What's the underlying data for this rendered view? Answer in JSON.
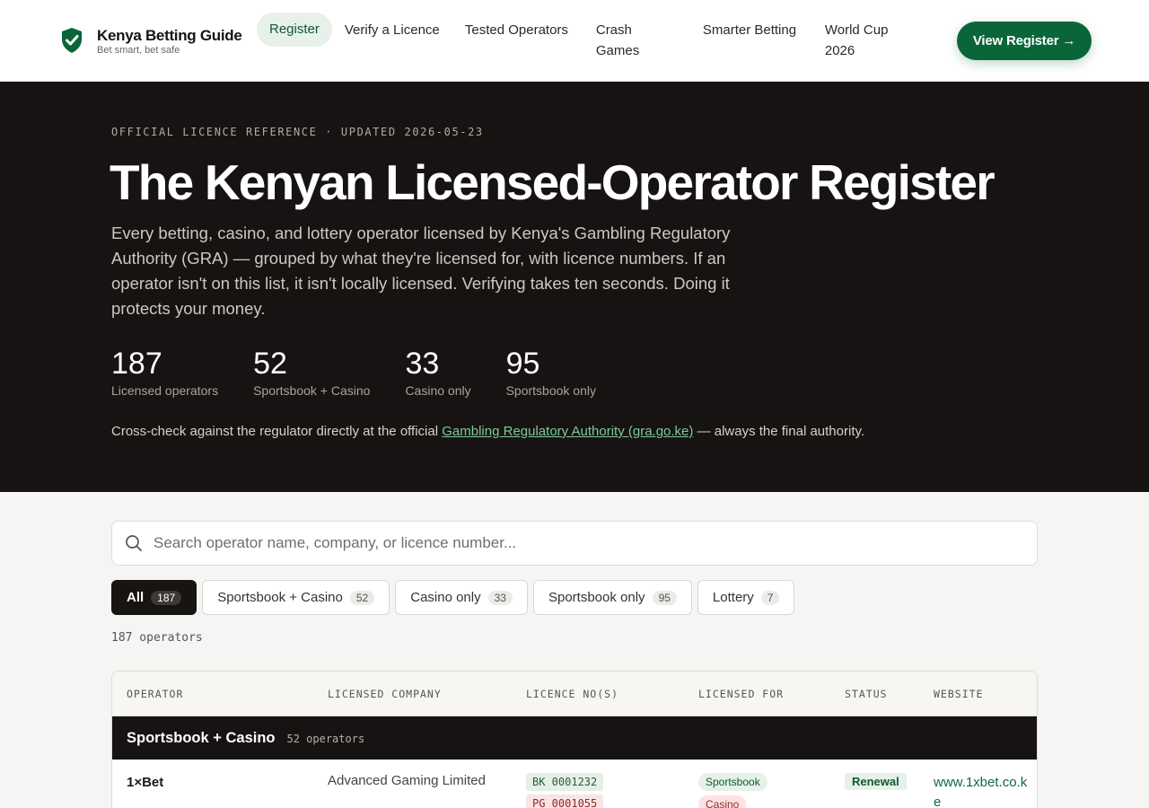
{
  "brand": {
    "name": "Kenya Betting Guide",
    "tagline": "Bet smart, bet safe"
  },
  "nav": {
    "items": [
      {
        "label": "Register"
      },
      {
        "label": "Verify a Licence"
      },
      {
        "label": "Tested Operators"
      },
      {
        "label": "Crash Games"
      },
      {
        "label": "Smarter Betting"
      },
      {
        "label": "World Cup 2026"
      }
    ],
    "cta": "View Register →"
  },
  "hero": {
    "eyebrow": "OFFICIAL LICENCE REFERENCE · UPDATED 2026-05-23",
    "title": "The Kenyan Licensed-Operator Register",
    "lede": "Every betting, casino, and lottery operator licensed by Kenya's Gambling Regulatory Authority (GRA) — grouped by what they're licensed for, with licence numbers. If an operator isn't on this list, it isn't locally licensed. Verifying takes ten seconds. Doing it protects your money.",
    "stats": [
      {
        "value": "187",
        "label": "Licensed operators"
      },
      {
        "value": "52",
        "label": "Sportsbook + Casino"
      },
      {
        "value": "33",
        "label": "Casino only"
      },
      {
        "value": "95",
        "label": "Sportsbook only"
      }
    ],
    "crosscheck_pre": "Cross-check against the regulator directly at the official",
    "crosscheck_link": "Gambling Regulatory Authority (gra.go.ke)",
    "crosscheck_post": "— always the final authority."
  },
  "search": {
    "placeholder": "Search operator name, company, or licence number..."
  },
  "filters": [
    {
      "label": "All",
      "count": "187"
    },
    {
      "label": "Sportsbook + Casino",
      "count": "52"
    },
    {
      "label": "Casino only",
      "count": "33"
    },
    {
      "label": "Sportsbook only",
      "count": "95"
    },
    {
      "label": "Lottery",
      "count": "7"
    }
  ],
  "result_count": "187 operators",
  "table": {
    "headers": [
      "OPERATOR",
      "LICENSED COMPANY",
      "LICENCE NO(S)",
      "LICENSED FOR",
      "STATUS",
      "WEBSITE"
    ],
    "group": {
      "title": "Sportsbook + Casino",
      "count": "52 operators"
    },
    "rows": [
      {
        "operator": "1×Bet",
        "company": "Advanced Gaming Limited",
        "licence_1": "BK 0001232",
        "licence_2": "PG 0001055",
        "tag_1": "Sportsbook",
        "tag_2": "Casino",
        "status": "Renewal",
        "website": "www.1xbet.co.ke"
      }
    ]
  },
  "colors": {
    "accent": "#0a6639",
    "dark": "#161312",
    "link": "#7fc99b"
  }
}
